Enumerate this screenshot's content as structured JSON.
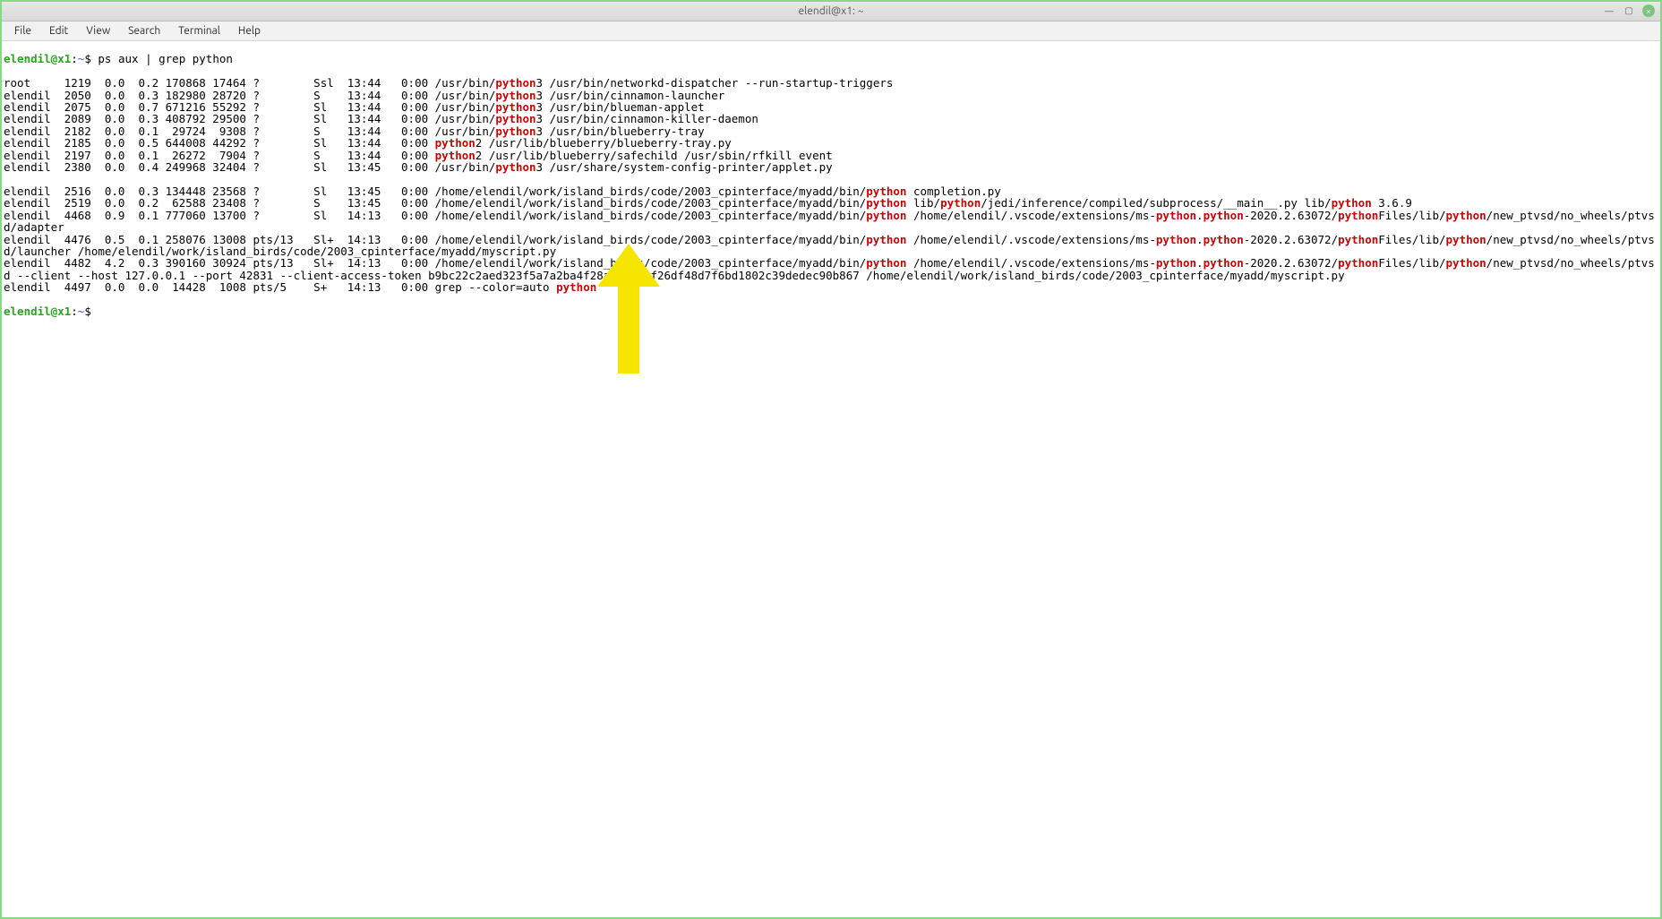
{
  "window": {
    "title": "elendil@x1: ~",
    "minimize_glyph": "—",
    "maximize_glyph": "▢",
    "close_glyph": "×"
  },
  "menu": {
    "file": "File",
    "edit": "Edit",
    "view": "View",
    "search": "Search",
    "terminal": "Terminal",
    "help": "Help"
  },
  "prompt": {
    "userhost": "elendil@x1",
    "sep": ":",
    "path": "~",
    "dollar": "$ ",
    "command": "ps aux | grep python"
  },
  "ps_rows": [
    {
      "user": "root   ",
      "pid": "  1219",
      "cpu": "  0.0",
      "mem": "  0.2",
      "vsz": " 170868",
      "rss": " 17464",
      "tty": " ?      ",
      "stat": "  Ssl ",
      "start": " 13:44",
      "time": "   0:00 ",
      "pre": "/usr/bin/",
      "hl": "python",
      "post": "3 /usr/bin/networkd-dispatcher --run-startup-triggers"
    },
    {
      "user": "elendil",
      "pid": "  2050",
      "cpu": "  0.0",
      "mem": "  0.3",
      "vsz": " 182980",
      "rss": " 28720",
      "tty": " ?      ",
      "stat": "  S   ",
      "start": " 13:44",
      "time": "   0:00 ",
      "pre": "/usr/bin/",
      "hl": "python",
      "post": "3 /usr/bin/cinnamon-launcher"
    },
    {
      "user": "elendil",
      "pid": "  2075",
      "cpu": "  0.0",
      "mem": "  0.7",
      "vsz": " 671216",
      "rss": " 55292",
      "tty": " ?      ",
      "stat": "  Sl  ",
      "start": " 13:44",
      "time": "   0:00 ",
      "pre": "/usr/bin/",
      "hl": "python",
      "post": "3 /usr/bin/blueman-applet"
    },
    {
      "user": "elendil",
      "pid": "  2089",
      "cpu": "  0.0",
      "mem": "  0.3",
      "vsz": " 408792",
      "rss": " 29500",
      "tty": " ?      ",
      "stat": "  Sl  ",
      "start": " 13:44",
      "time": "   0:00 ",
      "pre": "/usr/bin/",
      "hl": "python",
      "post": "3 /usr/bin/cinnamon-killer-daemon"
    },
    {
      "user": "elendil",
      "pid": "  2182",
      "cpu": "  0.0",
      "mem": "  0.1",
      "vsz": "  29724",
      "rss": "  9308",
      "tty": " ?      ",
      "stat": "  S   ",
      "start": " 13:44",
      "time": "   0:00 ",
      "pre": "/usr/bin/",
      "hl": "python",
      "post": "3 /usr/bin/blueberry-tray"
    },
    {
      "user": "elendil",
      "pid": "  2185",
      "cpu": "  0.0",
      "mem": "  0.5",
      "vsz": " 644008",
      "rss": " 44292",
      "tty": " ?      ",
      "stat": "  Sl  ",
      "start": " 13:44",
      "time": "   0:00 ",
      "pre": "",
      "hl": "python",
      "post": "2 /usr/lib/blueberry/blueberry-tray.py"
    },
    {
      "user": "elendil",
      "pid": "  2197",
      "cpu": "  0.0",
      "mem": "  0.1",
      "vsz": "  26272",
      "rss": "  7904",
      "tty": " ?      ",
      "stat": "  S   ",
      "start": " 13:44",
      "time": "   0:00 ",
      "pre": "",
      "hl": "python",
      "post": "2 /usr/lib/blueberry/safechild /usr/sbin/rfkill event"
    },
    {
      "user": "elendil",
      "pid": "  2380",
      "cpu": "  0.0",
      "mem": "  0.4",
      "vsz": " 249968",
      "rss": " 32404",
      "tty": " ?      ",
      "stat": "  Sl  ",
      "start": " 13:45",
      "time": "   0:00 ",
      "pre": "/usr/bin/",
      "hl": "python",
      "post": "3 /usr/share/system-config-printer/applet.py"
    }
  ],
  "tail": {
    "row_2516": {
      "user": "elendil",
      "pid": "  2516",
      "cpu": "  0.0",
      "mem": "  0.3",
      "vsz": " 134448",
      "rss": " 23568",
      "tty": " ?      ",
      "stat": "  Sl  ",
      "start": " 13:45",
      "time": "   0:00 ",
      "pre": "/home/elendil/work/island_birds/code/2003_cpinterface/myadd/bin/",
      "hl": "python",
      "mid": " completion.py"
    },
    "row_2519": {
      "user": "elendil",
      "pid": "  2519",
      "cpu": "  0.0",
      "mem": "  0.2",
      "vsz": "  62588",
      "rss": " 23408",
      "tty": " ?      ",
      "stat": "  S   ",
      "start": " 13:45",
      "time": "   0:00 ",
      "pre": "/home/elendil/work/island_birds/code/2003_cpinterface/myadd/bin/",
      "hl1": "python",
      "mid1": " lib/",
      "hl2": "python",
      "mid2": "/jedi/inference/compiled/subprocess/__main__.py lib/",
      "hl3": "python",
      "mid3": " 3.6.9"
    },
    "row_4468": {
      "user": "elendil",
      "pid": "  4468",
      "cpu": "  0.9",
      "mem": "  0.1",
      "vsz": " 777060",
      "rss": " 13700",
      "tty": " ?      ",
      "stat": "  Sl  ",
      "start": " 14:13",
      "time": "   0:00 ",
      "pre": "/home/elendil/work/island_birds/code/2003_cpinterface/myadd/bin/",
      "hl1": "python",
      "mid1": " /home/elendil/.vscode/extensions/ms-",
      "hl2": "python",
      "dot": ".",
      "hl3": "python",
      "mid2": "-2020.2.63072/",
      "hl4": "python",
      "mid3": "Files/lib/",
      "hl5": "python",
      "mid4": "/new_ptvsd/no_wheels/ptvsd/adapter"
    },
    "row_4476": {
      "user": "elendil",
      "pid": "  4476",
      "cpu": "  0.5",
      "mem": "  0.1",
      "vsz": " 258076",
      "rss": " 13008",
      "tty": " pts/13 ",
      "stat": "  Sl+ ",
      "start": " 14:13",
      "time": "   0:00 ",
      "pre": "/home/elendil/work/island_birds/code/2003_cpinterface/myadd/bin/",
      "hl1": "python",
      "mid1": " /home/elendil/.vscode/extensions/ms-",
      "hl2": "python",
      "dot": ".",
      "hl3": "python",
      "mid2": "-2020.2.63072/",
      "hl4": "python",
      "mid3": "Files/lib/",
      "hl5": "python",
      "mid4": "/new_ptvsd/no_wheels/ptvsd/launcher /home/elendil/work/island_birds/code/2003_cpinterface/myadd/myscript.py"
    },
    "row_4482": {
      "user": "elendil",
      "pid": "  4482",
      "cpu": "  4.2",
      "mem": "  0.3",
      "vsz": " 390160",
      "rss": " 30924",
      "tty": " pts/13 ",
      "stat": "  Sl+ ",
      "start": " 14:13",
      "time": "   0:00 ",
      "pre": "/home/elendil/work/island_birds/code/2003_cpinterface/myadd/bin/",
      "hl1": "python",
      "mid1": " /home/elendil/.vscode/extensions/ms-",
      "hl2": "python",
      "dot": ".",
      "hl3": "python",
      "mid2": "-2020.2.63072/",
      "hl4": "python",
      "mid3": "Files/lib/",
      "hl5": "python",
      "mid4": "/new_ptvsd/no_wheels/ptvsd --client --host 127.0.0.1 --port 42831 --client-access-token b9bc22c2aed323f5a7a2ba4f28ab1f1ecf26df48d7f6bd1802c39dedec90b867 /home/elendil/work/island_birds/code/2003_cpinterface/myadd/myscript.py"
    },
    "row_4497": {
      "user": "elendil",
      "pid": "  4497",
      "cpu": "  0.0",
      "mem": "  0.0",
      "vsz": "  14428",
      "rss": "  1008",
      "tty": " pts/5  ",
      "stat": "  S+  ",
      "start": " 14:13",
      "time": "   0:00 ",
      "pre": "grep --color=auto ",
      "hl": "python"
    }
  }
}
